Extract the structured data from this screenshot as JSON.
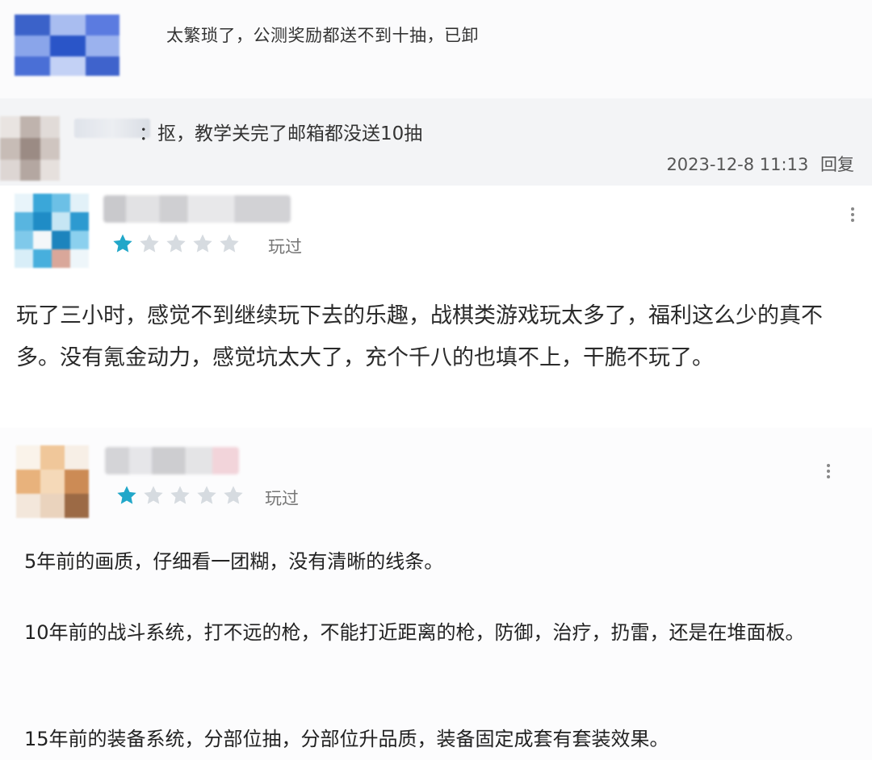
{
  "colors": {
    "star_active": "#21a7c9",
    "star_inactive": "#d6dbe0",
    "block1_bg": "#fbfbfc",
    "block2_bg": "#f3f4f6",
    "block3_bg": "#ffffff",
    "block4_bg": "#fcfcfd"
  },
  "reply_top": {
    "text": "太繁琐了，公测奖励都送不到十抽，已卸"
  },
  "reply_second": {
    "text": "：抠，教学关完了邮箱都没送10抽",
    "timestamp": "2023-12-8 11:13",
    "reply_label": "回复"
  },
  "review1": {
    "rating": 1,
    "max_rating": 5,
    "played_label": "玩过",
    "text": "玩了三小时，感觉不到继续玩下去的乐趣，战棋类游戏玩太多了，福利这么少的真不多。没有氪金动力，感觉坑太大了，充个千八的也填不上，干脆不玩了。"
  },
  "review2": {
    "rating": 1,
    "max_rating": 5,
    "played_label": "玩过",
    "paragraphs": [
      "5年前的画质，仔细看一团糊，没有清晰的线条。",
      "10年前的战斗系统，打不远的枪，不能打近距离的枪，防御，治疗，扔雷，还是在堆面板。",
      "15年前的装备系统，分部位抽，分部位升品质，装备固定成套有套装效果。"
    ]
  }
}
